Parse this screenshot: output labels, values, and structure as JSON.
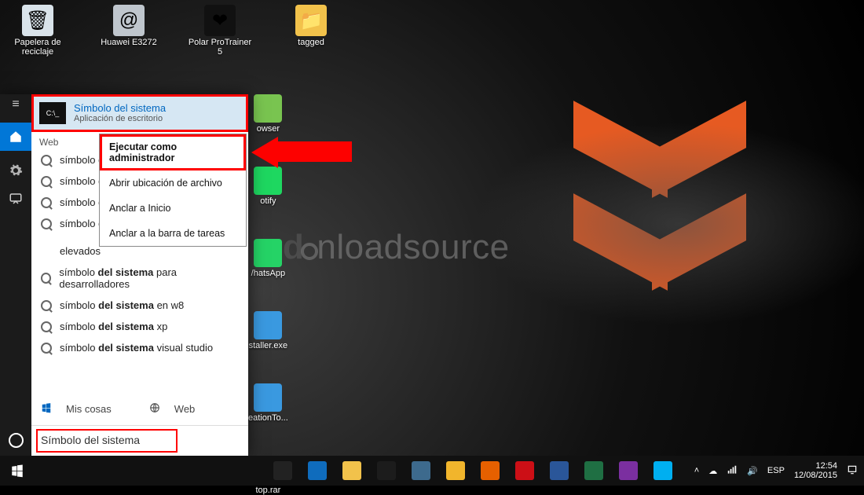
{
  "desktop": {
    "icons": [
      {
        "label": "Papelera de reciclaje",
        "bg": "#d9e3ea",
        "glyph": "🗑"
      },
      {
        "label": "Huawei E3272",
        "bg": "#bfc6cd",
        "glyph": "@"
      },
      {
        "label": "Polar ProTrainer 5",
        "bg": "#111",
        "glyph": "❤"
      },
      {
        "label": "tagged",
        "bg": "#f2c24b",
        "glyph": "📁"
      }
    ]
  },
  "behind": [
    {
      "label": "owser",
      "bg": "#79c450"
    },
    {
      "label": "otify",
      "bg": "#1ed760"
    },
    {
      "label": "/hatsApp",
      "bg": "#25d366"
    },
    {
      "label": "staller.exe",
      "bg": "#3a99e0"
    },
    {
      "label": "eationTo...",
      "bg": "#3a99e0"
    },
    {
      "label": "top.rar",
      "bg": "#7a3fa2"
    }
  ],
  "start": {
    "best_match": {
      "title": "Símbolo del sistema",
      "subtitle": "Aplicación de escritorio"
    },
    "section_label": "Web",
    "suggestions": [
      {
        "pre": "símbolo d",
        "bold": "",
        "post": ""
      },
      {
        "pre": "símbolo d",
        "bold": "",
        "post": ""
      },
      {
        "pre": "símbolo d",
        "bold": "",
        "post": ""
      },
      {
        "pre": "símbolo d",
        "bold": "",
        "post": "  elevados",
        "wrap": true
      },
      {
        "pre": "símbolo ",
        "bold": "del sistema",
        "post": " para desarrolladores"
      },
      {
        "pre": "símbolo ",
        "bold": "del sistema",
        "post": " en w8"
      },
      {
        "pre": "símbolo ",
        "bold": "del sistema",
        "post": " xp"
      },
      {
        "pre": "símbolo ",
        "bold": "del sistema",
        "post": " visual studio"
      }
    ],
    "filters": {
      "mine": "Mis cosas",
      "web": "Web"
    },
    "search_value": "Símbolo del sistema"
  },
  "context_menu": {
    "items": [
      "Ejecutar como administrador",
      "Abrir ubicación de archivo",
      "Anclar a Inicio",
      "Anclar a la barra de tareas"
    ]
  },
  "taskbar": {
    "apps": [
      {
        "name": "task-view",
        "bg": "#222"
      },
      {
        "name": "edge",
        "bg": "#0f6cbd"
      },
      {
        "name": "file-explorer",
        "bg": "#f2c24b"
      },
      {
        "name": "store",
        "bg": "#1c1c1c"
      },
      {
        "name": "weather",
        "bg": "#3d6a8d"
      },
      {
        "name": "chrome",
        "bg": "#f1b52c"
      },
      {
        "name": "firefox",
        "bg": "#e66000"
      },
      {
        "name": "opera",
        "bg": "#cc0f16"
      },
      {
        "name": "word",
        "bg": "#2a5699"
      },
      {
        "name": "excel",
        "bg": "#1f6f43"
      },
      {
        "name": "onenote",
        "bg": "#7b2fa0"
      },
      {
        "name": "skype",
        "bg": "#00aff0"
      }
    ],
    "lang": "ESP",
    "time": "12:54",
    "date": "12/08/2015"
  },
  "watermark": {
    "d": "d",
    "rest": "nloadsource"
  }
}
